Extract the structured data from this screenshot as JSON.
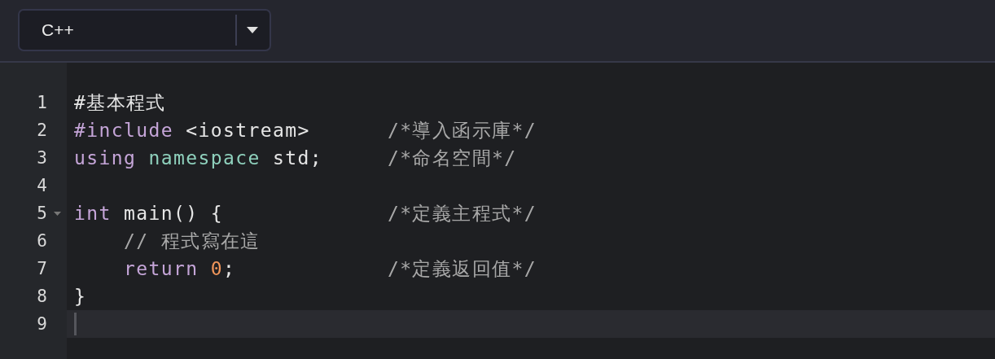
{
  "language_select": {
    "value": "C++"
  },
  "editor": {
    "lines": [
      {
        "number": "1",
        "foldable": false,
        "active": false,
        "tokens": [
          {
            "kind": "plain",
            "text": "#基本程式"
          }
        ]
      },
      {
        "number": "2",
        "foldable": false,
        "active": false,
        "tokens": [
          {
            "kind": "keyword",
            "text": "#include"
          },
          {
            "kind": "plain",
            "text": " <iostream>"
          }
        ],
        "comment": "/*導入函示庫*/"
      },
      {
        "number": "3",
        "foldable": false,
        "active": false,
        "tokens": [
          {
            "kind": "keyword",
            "text": "using"
          },
          {
            "kind": "type",
            "text": " namespace"
          },
          {
            "kind": "plain",
            "text": " std;"
          }
        ],
        "comment": "/*命名空間*/"
      },
      {
        "number": "4",
        "foldable": false,
        "active": false
      },
      {
        "number": "5",
        "foldable": true,
        "active": false,
        "tokens": [
          {
            "kind": "keyword",
            "text": "int"
          },
          {
            "kind": "plain",
            "text": " main() {"
          }
        ],
        "comment": "/*定義主程式*/"
      },
      {
        "number": "6",
        "foldable": false,
        "active": false,
        "tokens": [
          {
            "kind": "comment",
            "text": "    // 程式寫在這"
          }
        ]
      },
      {
        "number": "7",
        "foldable": false,
        "active": false,
        "tokens": [
          {
            "kind": "keyword",
            "text": "    return"
          },
          {
            "kind": "number",
            "text": " 0"
          },
          {
            "kind": "plain",
            "text": ";"
          }
        ],
        "comment": "/*定義返回值*/"
      },
      {
        "number": "8",
        "foldable": false,
        "active": false,
        "tokens": [
          {
            "kind": "plain",
            "text": "}"
          }
        ]
      },
      {
        "number": "9",
        "foldable": false,
        "active": true
      }
    ]
  }
}
